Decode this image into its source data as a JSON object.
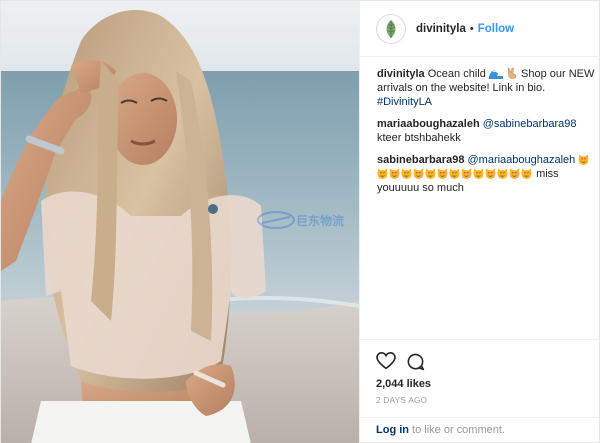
{
  "post": {
    "username": "divinityla",
    "separator": "•",
    "follow_label": "Follow"
  },
  "caption": {
    "user": "divinityla",
    "text_before_emoji": "Ocean child",
    "text_after_emoji": "Shop our NEW arrivals on the website! Link in bio.",
    "hashtag": "#DivinityLA",
    "emojis": [
      "wave-emoji",
      "victory-hand-emoji"
    ]
  },
  "comments": [
    {
      "user": "mariaaboughazaleh",
      "mention": "@sabinebarbara98",
      "text": "kteer btshbahekk"
    },
    {
      "user": "sabinebarbara98",
      "mention": "@mariaaboughazaleh",
      "emoji_count": 14,
      "emoji_name": "heart-eyes-cat-emoji",
      "text": "miss youuuuu so much"
    }
  ],
  "stats": {
    "likes": "2,044 likes",
    "time_ago": "2 DAYS AGO"
  },
  "login": {
    "link": "Log in",
    "rest": " to like or comment."
  },
  "watermark": "巨东物流",
  "colors": {
    "link_blue": "#3897f0",
    "mention_navy": "#003569",
    "text": "#262626",
    "muted": "#999999"
  },
  "icons": [
    "heart-icon",
    "comment-icon",
    "leaf-logo-icon"
  ]
}
